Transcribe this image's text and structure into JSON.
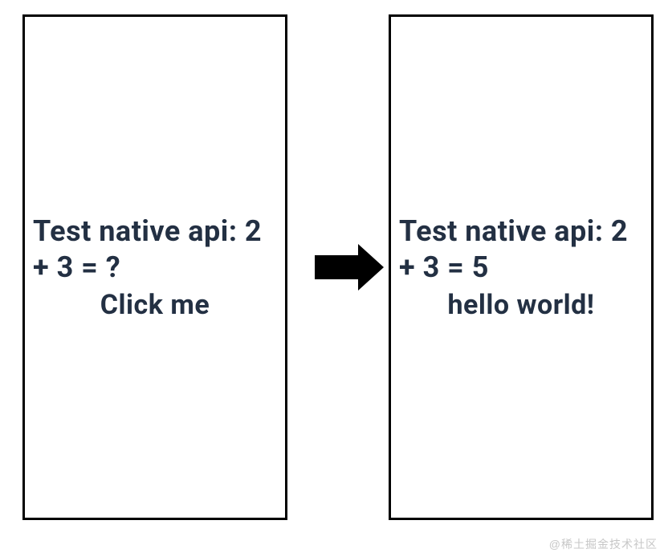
{
  "before": {
    "headline": "Test native api: 2 + 3 = ?",
    "action": "Click me"
  },
  "after": {
    "headline": "Test native api: 2 + 3 = 5",
    "action": "hello world!"
  },
  "watermark": "@稀土掘金技术社区"
}
